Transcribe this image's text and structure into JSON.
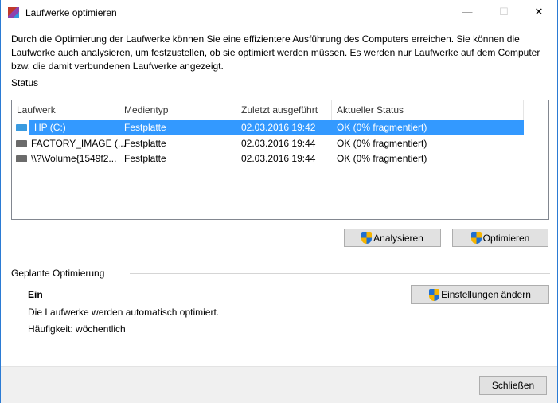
{
  "window": {
    "title": "Laufwerke optimieren",
    "minimize": "—",
    "maximize": "☐",
    "close": "✕"
  },
  "description": "Durch die Optimierung der Laufwerke können Sie eine effizientere Ausführung des Computers erreichen. Sie können die Laufwerke auch analysieren, um festzustellen, ob sie optimiert werden müssen. Es werden nur Laufwerke auf dem Computer bzw. die damit verbundenen Laufwerke angezeigt.",
  "status": {
    "label": "Status",
    "columns": [
      "Laufwerk",
      "Medientyp",
      "Zuletzt ausgeführt",
      "Aktueller Status"
    ],
    "rows": [
      {
        "drive": "HP (C:)",
        "media": "Festplatte",
        "last": "02.03.2016 19:42",
        "status": "OK (0% fragmentiert)"
      },
      {
        "drive": "FACTORY_IMAGE (...",
        "media": "Festplatte",
        "last": "02.03.2016 19:44",
        "status": "OK (0% fragmentiert)"
      },
      {
        "drive": "\\\\?\\Volume{1549f2...",
        "media": "Festplatte",
        "last": "02.03.2016 19:44",
        "status": "OK (0% fragmentiert)"
      }
    ]
  },
  "buttons": {
    "analyze": "Analysieren",
    "optimize": "Optimieren",
    "change_settings": "Einstellungen ändern",
    "close": "Schließen"
  },
  "scheduled": {
    "label": "Geplante Optimierung",
    "state": "Ein",
    "info": "Die Laufwerke werden automatisch optimiert.",
    "frequency": "Häufigkeit: wöchentlich"
  }
}
